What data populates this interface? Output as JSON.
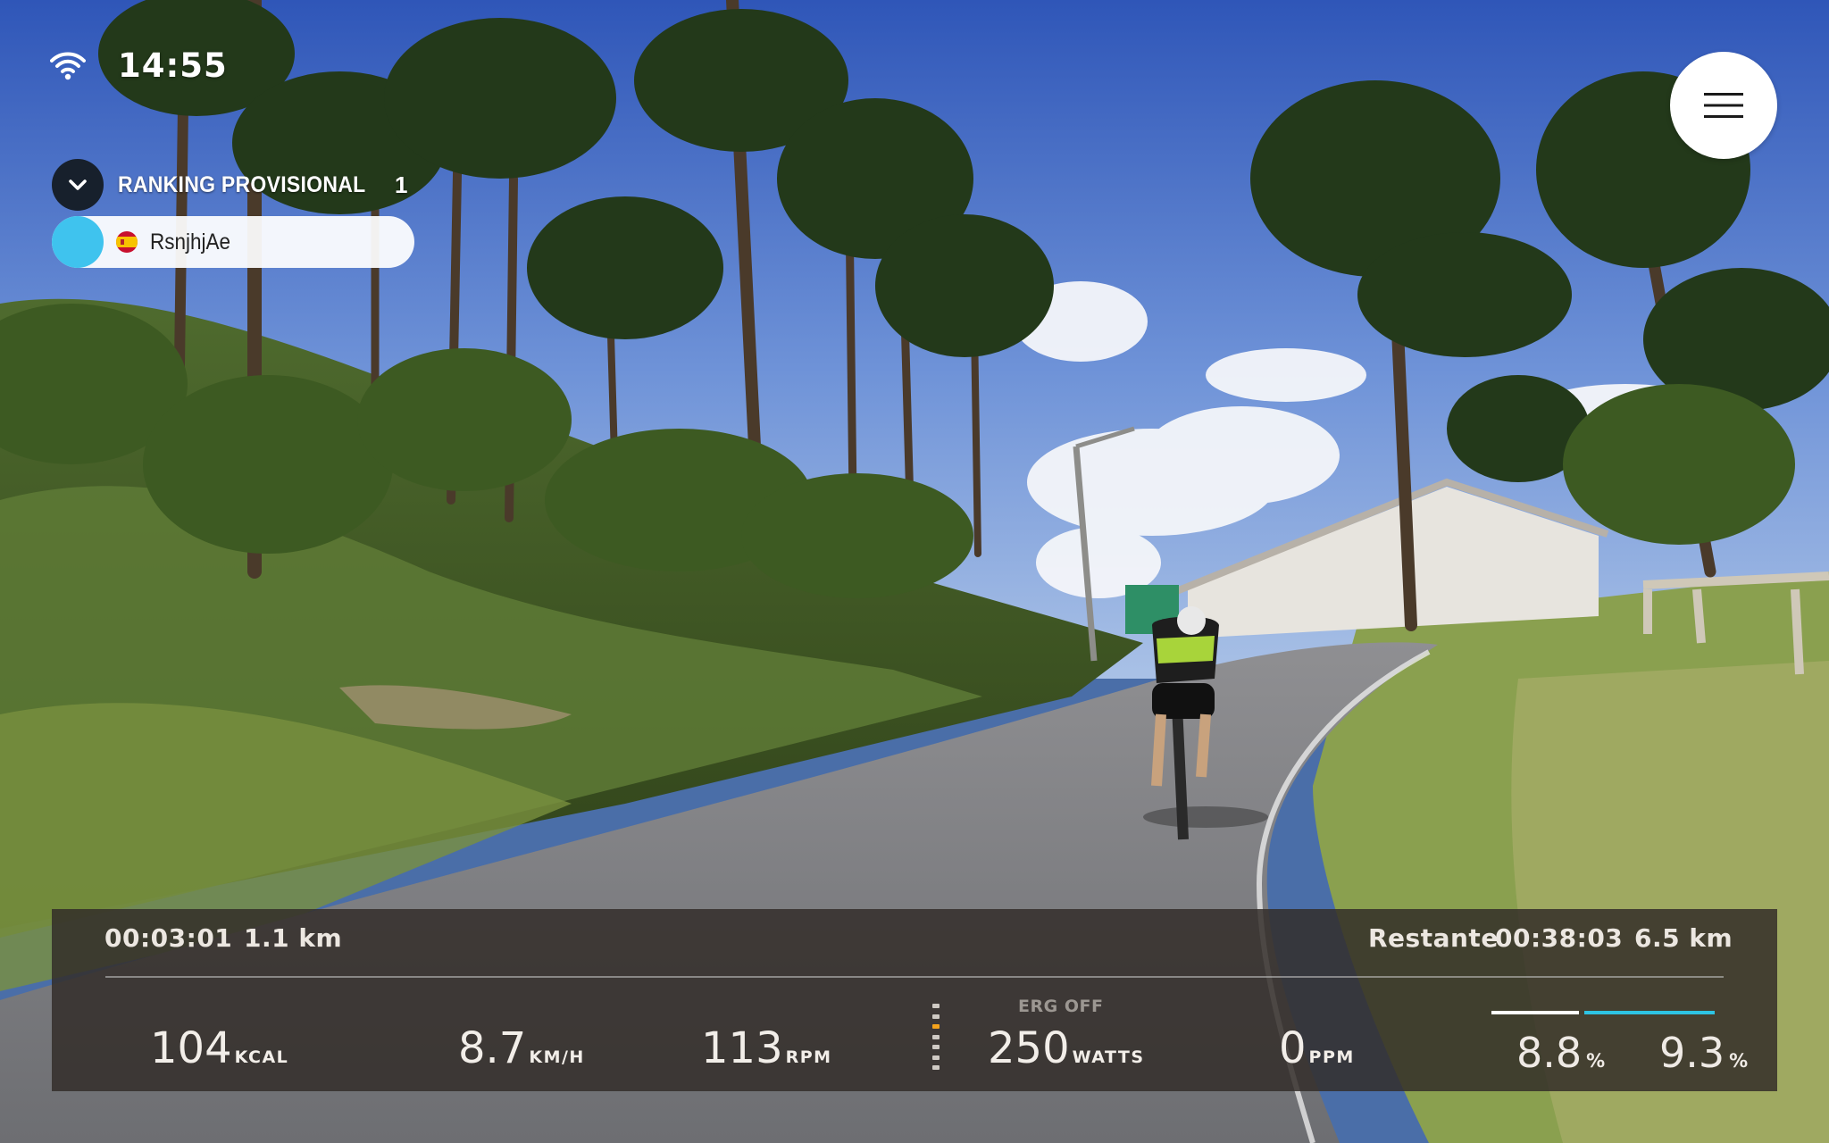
{
  "status": {
    "wifi_icon": "wifi-icon",
    "time": "14:55"
  },
  "ranking": {
    "toggle_icon": "chevron-down-icon",
    "title": "RANKING PROVISIONAL",
    "count": "1",
    "riders": [
      {
        "flag_icon": "flag-es-icon",
        "name": "RsnjhjAe",
        "color": "#3fc3ee"
      }
    ]
  },
  "menu": {
    "icon": "menu-icon"
  },
  "stats": {
    "elapsed_time": "00:03:01",
    "distance_done": "1.1 km",
    "remaining_label": "Restante",
    "remaining_time": "00:38:03",
    "remaining_distance": "6.5 km",
    "kcal": {
      "value": "104",
      "unit": "KCAL"
    },
    "speed": {
      "value": "8.7",
      "unit": "KM/H"
    },
    "cadence": {
      "value": "113",
      "unit": "RPM"
    },
    "erg_mode": "ERG OFF",
    "resistance_level": {
      "current": 3,
      "total": 7
    },
    "power": {
      "value": "250",
      "unit": "WATTS"
    },
    "heart_rate": {
      "value": "0",
      "unit": "PPM"
    },
    "slope_current": {
      "value": "8.8",
      "unit": "%"
    },
    "slope_next": {
      "value": "9.3",
      "unit": "%"
    },
    "route_progress": 0.39,
    "colors": {
      "accent": "#2ec4e4",
      "erg_active": "#f4a31c",
      "rider": "#3fc3ee"
    }
  }
}
